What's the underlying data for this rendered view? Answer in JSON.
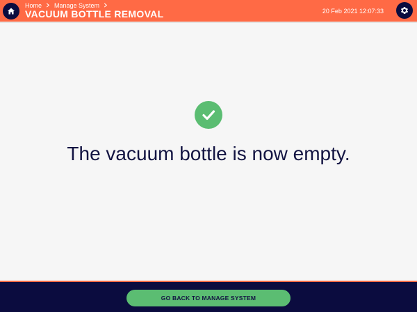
{
  "header": {
    "breadcrumb": [
      "Home",
      "Manage System"
    ],
    "title": "VACUUM BOTTLE REMOVAL",
    "datetime": "20 Feb 2021 12:07:33",
    "home_icon": "home-icon",
    "settings_icon": "gear-icon"
  },
  "main": {
    "status_icon": "check-circle-icon",
    "message": "The vacuum bottle is now empty."
  },
  "footer": {
    "back_button_label": "GO BACK TO MANAGE SYSTEM"
  },
  "colors": {
    "header_bg": "#ff6a45",
    "navy": "#0b0c3f",
    "success_green": "#5bbd72",
    "background": "#f6f6f6"
  }
}
